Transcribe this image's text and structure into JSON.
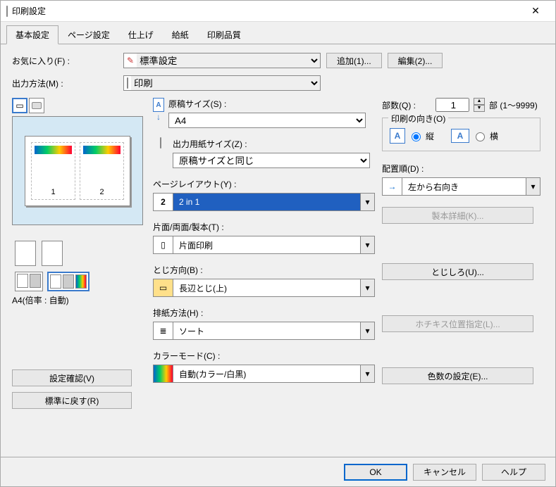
{
  "window": {
    "title": "印刷設定"
  },
  "tabs": [
    "基本設定",
    "ページ設定",
    "仕上げ",
    "給紙",
    "印刷品質"
  ],
  "active_tab": 0,
  "favorite": {
    "label": "お気に入り(F) :",
    "value": "標準設定",
    "add_btn": "追加(1)...",
    "edit_btn": "編集(2)..."
  },
  "output_method": {
    "label": "出力方法(M) :",
    "value": "印刷"
  },
  "preview": {
    "caption": "A4(倍率 : 自動)",
    "page1": "1",
    "page2": "2",
    "confirm_btn": "設定確認(V)",
    "reset_btn": "標準に戻す(R)"
  },
  "doc_size": {
    "label": "原稿サイズ(S) :",
    "value": "A4"
  },
  "out_size": {
    "label": "出力用紙サイズ(Z) :",
    "value": "原稿サイズと同じ"
  },
  "layout": {
    "label": "ページレイアウト(Y) :",
    "value": "2 in 1",
    "icon_text": "2"
  },
  "duplex": {
    "label": "片面/両面/製本(T) :",
    "value": "片面印刷"
  },
  "binding": {
    "label": "とじ方向(B) :",
    "value": "長辺とじ(上)"
  },
  "finishing": {
    "label": "排紙方法(H) :",
    "value": "ソート"
  },
  "colormode": {
    "label": "カラーモード(C) :",
    "value": "自動(カラー/白黒)"
  },
  "copies": {
    "label": "部数(Q) :",
    "value": 1,
    "range": "部 (1～9999)"
  },
  "orientation": {
    "legend": "印刷の向き(O)",
    "portrait": "縦",
    "landscape": "横",
    "selected": "portrait"
  },
  "order": {
    "label": "配置順(D) :",
    "value": "左から右向き"
  },
  "right_buttons": {
    "booklet_detail": "製本詳細(K)...",
    "gutter": "とじしろ(U)...",
    "staple_pos": "ホチキス位置指定(L)...",
    "color_count": "色数の設定(E)..."
  },
  "footer": {
    "ok": "OK",
    "cancel": "キャンセル",
    "help": "ヘルプ"
  }
}
